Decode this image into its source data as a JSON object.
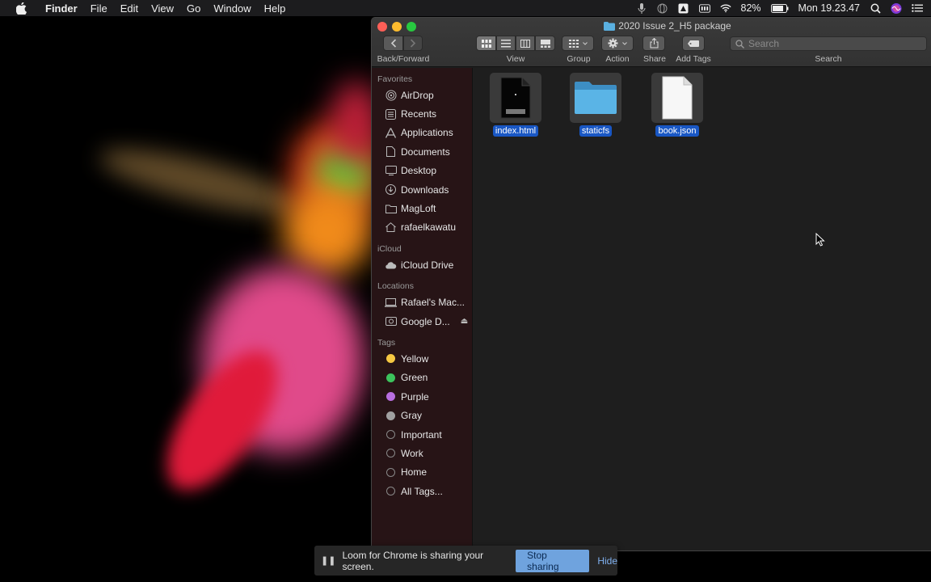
{
  "menubar": {
    "app_name": "Finder",
    "menus": [
      "File",
      "Edit",
      "View",
      "Go",
      "Window",
      "Help"
    ],
    "battery": "82%",
    "clock": "Mon 19.23.47",
    "icons": [
      "microphone-icon",
      "globe-icon",
      "adobe-icon",
      "keyboard-icon",
      "wifi-icon",
      "battery-icon",
      "spotlight-icon",
      "siri-icon",
      "notification-center-icon"
    ]
  },
  "window": {
    "title": "2020 Issue 2_H5 package",
    "toolbar": {
      "back_forward_label": "Back/Forward",
      "view_label": "View",
      "group_label": "Group",
      "action_label": "Action",
      "share_label": "Share",
      "add_tags_label": "Add Tags",
      "search_label": "Search",
      "search_placeholder": "Search"
    },
    "sidebar": {
      "favorites_header": "Favorites",
      "favorites": [
        {
          "label": "AirDrop",
          "icon": "airdrop-icon"
        },
        {
          "label": "Recents",
          "icon": "recents-icon"
        },
        {
          "label": "Applications",
          "icon": "applications-icon"
        },
        {
          "label": "Documents",
          "icon": "documents-icon"
        },
        {
          "label": "Desktop",
          "icon": "desktop-icon"
        },
        {
          "label": "Downloads",
          "icon": "downloads-icon"
        },
        {
          "label": "MagLoft",
          "icon": "folder-icon"
        },
        {
          "label": "rafaelkawatu",
          "icon": "home-icon"
        }
      ],
      "icloud_header": "iCloud",
      "icloud": [
        {
          "label": "iCloud Drive",
          "icon": "cloud-icon"
        }
      ],
      "locations_header": "Locations",
      "locations": [
        {
          "label": "Rafael's Mac...",
          "icon": "laptop-icon"
        },
        {
          "label": "Google D...",
          "icon": "drive-icon"
        }
      ],
      "tags_header": "Tags",
      "tags": [
        {
          "label": "Yellow",
          "color": "#f5c842"
        },
        {
          "label": "Green",
          "color": "#3cc35c"
        },
        {
          "label": "Purple",
          "color": "#b86ee0"
        },
        {
          "label": "Gray",
          "color": "#a0a0a0"
        },
        {
          "label": "Important",
          "color": ""
        },
        {
          "label": "Work",
          "color": ""
        },
        {
          "label": "Home",
          "color": ""
        },
        {
          "label": "All Tags...",
          "color": ""
        }
      ]
    },
    "files": [
      {
        "name": "index.html",
        "type": "html-file-icon"
      },
      {
        "name": "staticfs",
        "type": "folder-icon"
      },
      {
        "name": "book.json",
        "type": "document-icon"
      }
    ]
  },
  "loom": {
    "message": "Loom for Chrome is sharing your screen.",
    "stop_label": "Stop sharing",
    "hide_label": "Hide"
  },
  "colors": {
    "selection": "#1957c4",
    "folder": "#4aa3d8",
    "close": "#fe5f57",
    "minimize": "#febc2e",
    "zoom": "#28c840"
  }
}
